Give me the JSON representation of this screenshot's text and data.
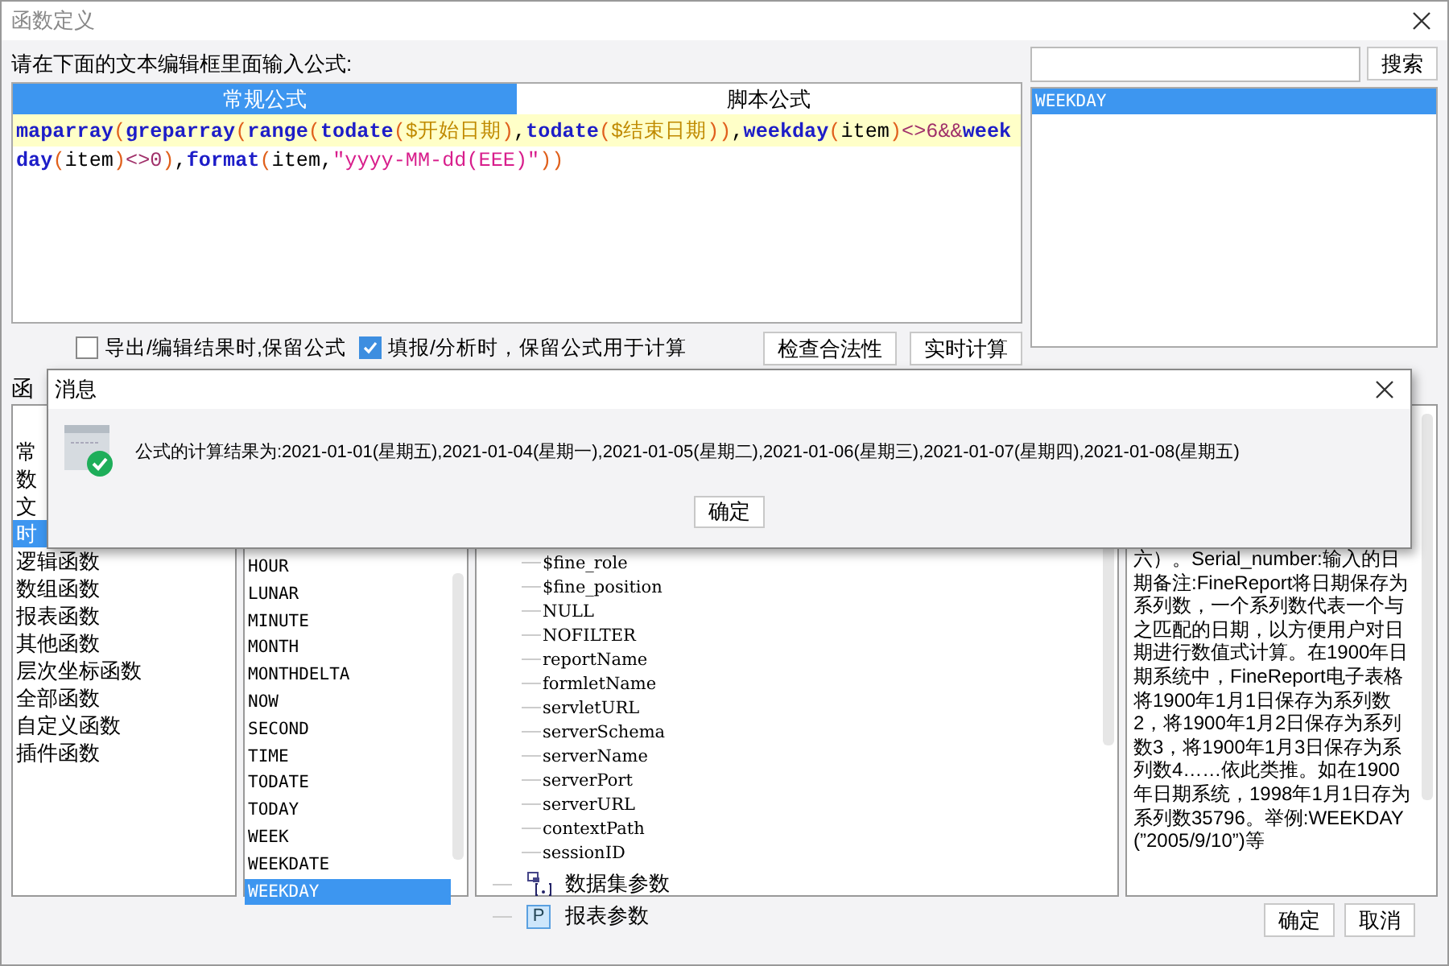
{
  "window": {
    "title": "函数定义"
  },
  "prompt": "请在下面的文本编辑框里面输入公式:",
  "search": {
    "button": "搜索"
  },
  "editor_tabs": [
    {
      "label": "常规公式",
      "selected": true
    },
    {
      "label": "脚本公式",
      "selected": false
    }
  ],
  "formula": [
    {
      "text": "maparray",
      "kind": "func"
    },
    {
      "text": "(",
      "kind": "paren"
    },
    {
      "text": "greparray",
      "kind": "func"
    },
    {
      "text": "(",
      "kind": "paren"
    },
    {
      "text": "range",
      "kind": "func"
    },
    {
      "text": "(",
      "kind": "paren"
    },
    {
      "text": "todate",
      "kind": "func"
    },
    {
      "text": "(",
      "kind": "paren"
    },
    {
      "text": "$开始日期",
      "kind": "param"
    },
    {
      "text": ")",
      "kind": "paren"
    },
    {
      "text": ",",
      "kind": "plain"
    },
    {
      "text": "todate",
      "kind": "func"
    },
    {
      "text": "(",
      "kind": "paren"
    },
    {
      "text": "$结束日期",
      "kind": "param"
    },
    {
      "text": "))",
      "kind": "paren"
    },
    {
      "text": ",",
      "kind": "plain"
    },
    {
      "text": "weekday",
      "kind": "func"
    },
    {
      "text": "(",
      "kind": "paren"
    },
    {
      "text": "item",
      "kind": "plain"
    },
    {
      "text": ")",
      "kind": "paren"
    },
    {
      "text": "<>6&&",
      "kind": "op"
    },
    {
      "text": "weekday",
      "kind": "func"
    },
    {
      "text": "(",
      "kind": "paren"
    },
    {
      "text": "item",
      "kind": "plain"
    },
    {
      "text": ")",
      "kind": "paren"
    },
    {
      "text": "<>0",
      "kind": "op"
    },
    {
      "text": ")",
      "kind": "paren"
    },
    {
      "text": ",",
      "kind": "plain"
    },
    {
      "text": "format",
      "kind": "func"
    },
    {
      "text": "(",
      "kind": "paren"
    },
    {
      "text": "item",
      "kind": "plain"
    },
    {
      "text": ",",
      "kind": "plain"
    },
    {
      "text": "\"yyyy-MM-dd(EEE)\"",
      "kind": "string"
    },
    {
      "text": "))",
      "kind": "paren"
    }
  ],
  "search_results": [
    {
      "label": "WEEKDAY",
      "selected": true
    }
  ],
  "options": [
    {
      "label": "导出/编辑结果时,保留公式",
      "checked": false
    },
    {
      "label": "填报/分析时，保留公式用于计算",
      "checked": true
    }
  ],
  "action_buttons": [
    "检查合法性",
    "实时计算"
  ],
  "category_heading": "函",
  "categories": [
    {
      "label": "常",
      "selected": false
    },
    {
      "label": "数",
      "selected": false
    },
    {
      "label": "文",
      "selected": false
    },
    {
      "label": "时",
      "selected": true
    },
    {
      "label": "逻辑函数",
      "selected": false
    },
    {
      "label": "数组函数",
      "selected": false
    },
    {
      "label": "报表函数",
      "selected": false
    },
    {
      "label": "其他函数",
      "selected": false
    },
    {
      "label": "层次坐标函数",
      "selected": false
    },
    {
      "label": "全部函数",
      "selected": false
    },
    {
      "label": "自定义函数",
      "selected": false
    },
    {
      "label": "插件函数",
      "selected": false
    }
  ],
  "functions": [
    {
      "label": "HOUR",
      "selected": false
    },
    {
      "label": "LUNAR",
      "selected": false
    },
    {
      "label": "MINUTE",
      "selected": false
    },
    {
      "label": "MONTH",
      "selected": false
    },
    {
      "label": "MONTHDELTA",
      "selected": false
    },
    {
      "label": "NOW",
      "selected": false
    },
    {
      "label": "SECOND",
      "selected": false
    },
    {
      "label": "TIME",
      "selected": false
    },
    {
      "label": "TODATE",
      "selected": false
    },
    {
      "label": "TODAY",
      "selected": false
    },
    {
      "label": "WEEK",
      "selected": false
    },
    {
      "label": "WEEKDATE",
      "selected": false
    },
    {
      "label": "WEEKDAY",
      "selected": true
    }
  ],
  "tree": [
    {
      "kind": "group",
      "children": [
        {
          "label": "$fine_role"
        },
        {
          "label": "$fine_position"
        },
        {
          "label": "NULL"
        },
        {
          "label": "NOFILTER"
        },
        {
          "label": "reportName"
        },
        {
          "label": "formletName"
        },
        {
          "label": "servletURL"
        },
        {
          "label": "serverSchema"
        },
        {
          "label": "serverName"
        },
        {
          "label": "serverPort"
        },
        {
          "label": "serverURL"
        },
        {
          "label": "contextPath"
        },
        {
          "label": "sessionID"
        }
      ]
    },
    {
      "kind": "dataset",
      "label": "数据集参数"
    },
    {
      "kind": "report",
      "badge": "P",
      "label": "报表参数"
    }
  ],
  "description": "六）。Serial_number:输入的日期备注:FineReport将日期保存为系列数，一个系列数代表一个与之匹配的日期，以方便用户对日期进行数值式计算。在1900年日期系统中，FineReport电子表格将1900年1月1日保存为系列数2，将1900年1月2日保存为系列数3，将1900年1月3日保存为系列数4……依此类推。如在1900年日期系统，1998年1月1日存为系列数35796。举例:WEEKDAY(”2005/9/10”)等",
  "footer_buttons": [
    "确定",
    "取消"
  ],
  "message_dialog": {
    "title": "消息",
    "text": "公式的计算结果为:2021-01-01(星期五),2021-01-04(星期一),2021-01-05(星期二),2021-01-06(星期三),2021-01-07(星期四),2021-01-08(星期五)",
    "button": "确定"
  }
}
